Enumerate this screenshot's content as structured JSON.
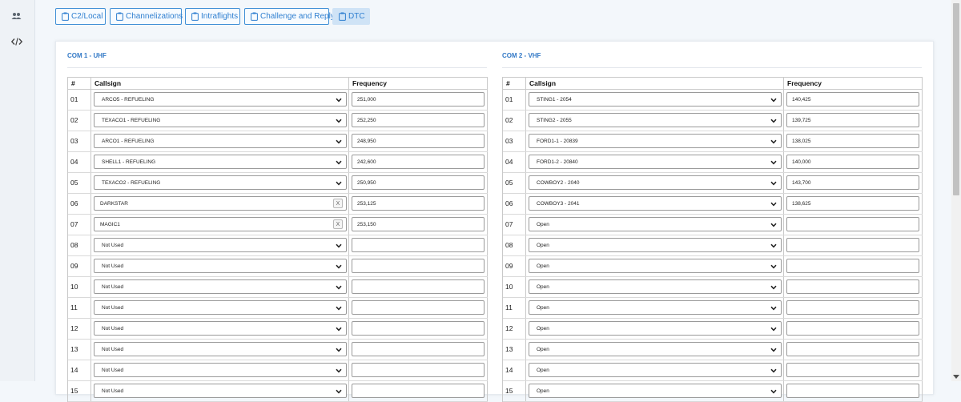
{
  "sidebar": {
    "items": [
      {
        "icon": "users-gear-icon"
      },
      {
        "icon": "code-icon"
      }
    ]
  },
  "tabs": [
    {
      "label": "C2/Local",
      "active": false
    },
    {
      "label": "Channelizations",
      "active": false
    },
    {
      "label": "Intraflights",
      "active": false
    },
    {
      "label": "Challenge and Reply",
      "active": false
    },
    {
      "label": "DTC",
      "active": true
    }
  ],
  "com1": {
    "title": "COM 1 - UHF",
    "headers": {
      "num": "#",
      "callsign": "Callsign",
      "frequency": "Frequency"
    },
    "rows": [
      {
        "num": "01",
        "callsign": "ARCO5 - REFUELING",
        "type": "select",
        "frequency": "251,000"
      },
      {
        "num": "02",
        "callsign": "TEXACO1 - REFUELING",
        "type": "select",
        "frequency": "252,250"
      },
      {
        "num": "03",
        "callsign": "ARCO1 - REFUELING",
        "type": "select",
        "frequency": "248,950"
      },
      {
        "num": "04",
        "callsign": "SHELL1 - REFUELING",
        "type": "select",
        "frequency": "242,600"
      },
      {
        "num": "05",
        "callsign": "TEXACO2 - REFUELING",
        "type": "select",
        "frequency": "250,950"
      },
      {
        "num": "06",
        "callsign": "DARKSTAR",
        "type": "text",
        "frequency": "253,125"
      },
      {
        "num": "07",
        "callsign": "MAGIC1",
        "type": "text",
        "frequency": "253,150"
      },
      {
        "num": "08",
        "callsign": "Not Used",
        "type": "select",
        "frequency": ""
      },
      {
        "num": "09",
        "callsign": "Not Used",
        "type": "select",
        "frequency": ""
      },
      {
        "num": "10",
        "callsign": "Not Used",
        "type": "select",
        "frequency": ""
      },
      {
        "num": "11",
        "callsign": "Not Used",
        "type": "select",
        "frequency": ""
      },
      {
        "num": "12",
        "callsign": "Not Used",
        "type": "select",
        "frequency": ""
      },
      {
        "num": "13",
        "callsign": "Not Used",
        "type": "select",
        "frequency": ""
      },
      {
        "num": "14",
        "callsign": "Not Used",
        "type": "select",
        "frequency": ""
      },
      {
        "num": "15",
        "callsign": "Not Used",
        "type": "select",
        "frequency": ""
      }
    ]
  },
  "com2": {
    "title": "COM 2 - VHF",
    "headers": {
      "num": "#",
      "callsign": "Callsign",
      "frequency": "Frequency"
    },
    "rows": [
      {
        "num": "01",
        "callsign": "STING1 - 2054",
        "type": "select",
        "frequency": "140,425"
      },
      {
        "num": "02",
        "callsign": "STING2 - 2055",
        "type": "select",
        "frequency": "139,725"
      },
      {
        "num": "03",
        "callsign": "FORD1-1 - 20839",
        "type": "select",
        "frequency": "138,025"
      },
      {
        "num": "04",
        "callsign": "FORD1-2 - 20840",
        "type": "select",
        "frequency": "140,000"
      },
      {
        "num": "05",
        "callsign": "COWBOY2 - 2040",
        "type": "select",
        "frequency": "143,700"
      },
      {
        "num": "06",
        "callsign": "COWBOY3 - 2041",
        "type": "select",
        "frequency": "138,625"
      },
      {
        "num": "07",
        "callsign": "Open",
        "type": "select",
        "frequency": ""
      },
      {
        "num": "08",
        "callsign": "Open",
        "type": "select",
        "frequency": ""
      },
      {
        "num": "09",
        "callsign": "Open",
        "type": "select",
        "frequency": ""
      },
      {
        "num": "10",
        "callsign": "Open",
        "type": "select",
        "frequency": ""
      },
      {
        "num": "11",
        "callsign": "Open",
        "type": "select",
        "frequency": ""
      },
      {
        "num": "12",
        "callsign": "Open",
        "type": "select",
        "frequency": ""
      },
      {
        "num": "13",
        "callsign": "Open",
        "type": "select",
        "frequency": ""
      },
      {
        "num": "14",
        "callsign": "Open",
        "type": "select",
        "frequency": ""
      },
      {
        "num": "15",
        "callsign": "Open",
        "type": "select",
        "frequency": ""
      }
    ]
  },
  "colors": {
    "accent": "#2f7fd0",
    "active_tab_bg": "#cfe3f6",
    "title": "#3178c6"
  }
}
